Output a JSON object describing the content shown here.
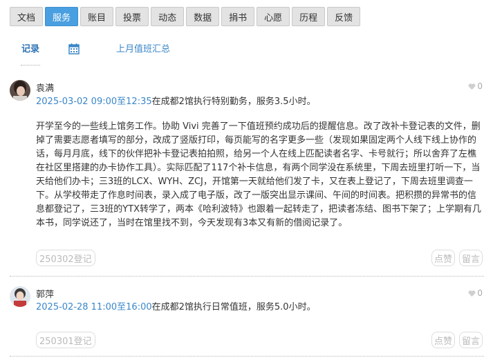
{
  "nav": {
    "items": [
      "文档",
      "服务",
      "账目",
      "投票",
      "动态",
      "数据",
      "捐书",
      "心愿",
      "历程",
      "反馈"
    ],
    "active_index": 1,
    "active_color": "#4a9fe0"
  },
  "subtabs": {
    "record_label": "记录",
    "calendar_icon": "calendar-icon",
    "summary_label": "上月值班汇总"
  },
  "posts": [
    {
      "author": "袁满",
      "likes": "0",
      "time_range": "2025-03-02 09:00至12:35",
      "meta_text": "在成都2馆执行特别勤务，服务3.5小时。",
      "body": "开学至今的一些线上馆务工作。协助 Vivi 完善了一下值班预约成功后的提醒信息。改了改补卡登记表的文件，删掉了需要志愿者填写的部分，改成了竖版打印，每页能写的名字更多一些（发现如果固定两个人线下线上协作的话，每月月底，线下的伙伴把补卡登记表拍拍照，给另一个人在线上匹配读者名字、卡号就行；所以舍弃了左樵在社区里搭建的办卡协作工具）。实际匹配了117个补卡信息，有两个同学没在系统里，下周去班里打听一下，当天给他们办卡；三3班的LCX、WYH、ZCJ，开馆第一天就给他们发了卡，又在表上登记了，下周去班里调查一下。从学校带走了作息时间表，录入成了电子版，改了一版突出显示课间、午间的时间表。把积攒的异常书的信息都登记了，三3班的YTX转学了，两本《哈利波特》也跟着一起转走了，把读者冻结、图书下架了；上学期有几本书，同学说还了，当时在馆里找不到，今天发现有3本又有新的借阅记录了。",
      "tag": "250302登记",
      "like_label": "点赞",
      "comment_label": "留言"
    },
    {
      "author": "郭萍",
      "likes": "0",
      "time_range": "2025-02-28 11:00至16:00",
      "meta_text": "在成都2馆执行日常值班，服务5.0小时。",
      "tag": "250301登记",
      "like_label": "点赞",
      "comment_label": "留言"
    }
  ]
}
